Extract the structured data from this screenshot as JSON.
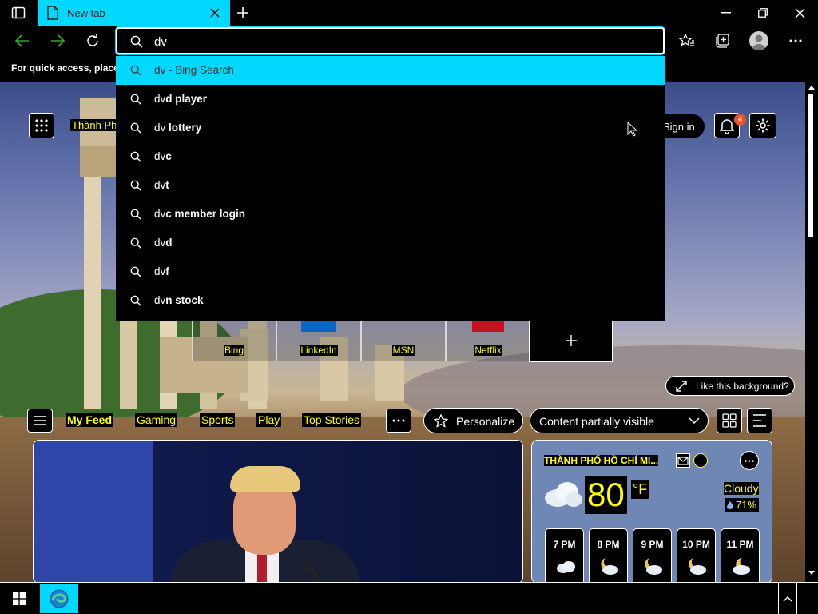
{
  "browser": {
    "tab_title": "New tab",
    "address_value": "dv"
  },
  "favorites_hint": "For quick access, place y",
  "suggestions": [
    {
      "typed": "dv",
      "rest": " - Bing Search",
      "bold": false
    },
    {
      "typed": "dv",
      "rest": "d player",
      "bold": true
    },
    {
      "typed": "dv",
      "rest": " lottery",
      "bold": true
    },
    {
      "typed": "dv",
      "rest": "c",
      "bold": true
    },
    {
      "typed": "dv",
      "rest": "t",
      "bold": true
    },
    {
      "typed": "dv",
      "rest": "c member login",
      "bold": true
    },
    {
      "typed": "dv",
      "rest": "d",
      "bold": true
    },
    {
      "typed": "dv",
      "rest": "f",
      "bold": true
    },
    {
      "typed": "dv",
      "rest": "n stock",
      "bold": true
    }
  ],
  "page": {
    "location_label": "Thành Ph",
    "sign_in": "Sign in",
    "notification_count": "4",
    "tiles": [
      "Bing",
      "LinkedIn",
      "MSN",
      "Netflix"
    ],
    "like_background": "Like this background?",
    "feed_tabs": [
      "My Feed",
      "Gaming",
      "Sports",
      "Play",
      "Top Stories"
    ],
    "personalize": "Personalize",
    "content_visibility": "Content partially visible"
  },
  "weather": {
    "location": "THÀNH PHỐ HỒ CHÍ MI...",
    "temperature": "80",
    "unit": "°F",
    "condition": "Cloudy",
    "precipitation": "71%",
    "hours": [
      "7 PM",
      "8 PM",
      "9 PM",
      "10 PM",
      "11 PM"
    ]
  },
  "colors": {
    "accent": "#00d8ff",
    "highlight_text": "#ffff00",
    "badge": "#e8552a"
  }
}
